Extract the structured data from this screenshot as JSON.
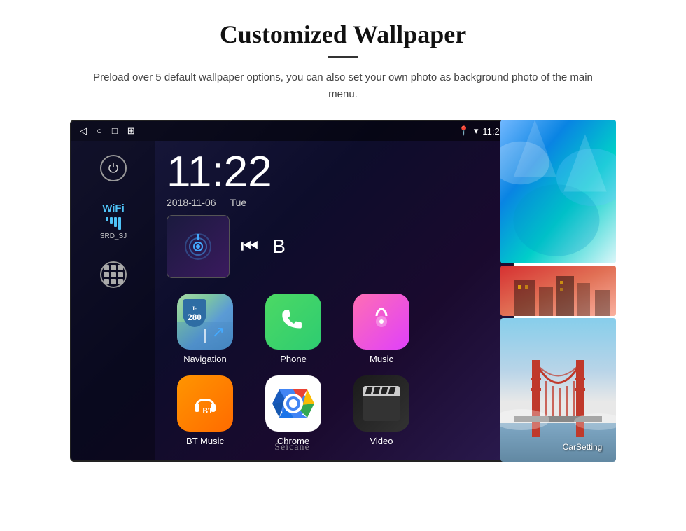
{
  "page": {
    "title": "Customized Wallpaper",
    "description": "Preload over 5 default wallpaper options, you can also set your own photo as background photo of the main menu."
  },
  "status_bar": {
    "time": "11:22",
    "nav_icons": [
      "◁",
      "○",
      "□",
      "⊞"
    ],
    "location_icon": "📍",
    "wifi_icon": "▼",
    "watermark": "Seicane"
  },
  "clock": {
    "time": "11:22",
    "date": "2018-11-06",
    "day": "Tue"
  },
  "wifi": {
    "label": "WiFi",
    "network": "SRD_SJ"
  },
  "apps": [
    {
      "name": "Navigation",
      "type": "navigation"
    },
    {
      "name": "Phone",
      "type": "phone"
    },
    {
      "name": "Music",
      "type": "music"
    },
    {
      "name": "BT Music",
      "type": "bt"
    },
    {
      "name": "Chrome",
      "type": "chrome"
    },
    {
      "name": "Video",
      "type": "video"
    }
  ],
  "carsetting": {
    "label": "CarSetting"
  },
  "navigation": {
    "badge_top": "I-280",
    "badge_num": "280"
  }
}
